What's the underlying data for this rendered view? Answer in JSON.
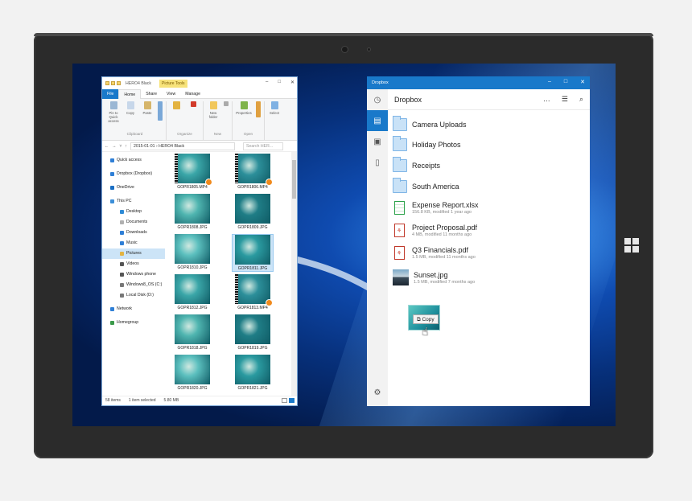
{
  "explorer": {
    "title": "HERO4 Black",
    "context_tab": "Picture Tools",
    "window_controls": [
      "–",
      "□",
      "✕"
    ],
    "tabs": [
      "File",
      "Home",
      "Share",
      "View",
      "Manage"
    ],
    "ribbon": {
      "clipboard": {
        "label": "Clipboard",
        "buttons": [
          "Pin to Quick access",
          "Copy",
          "Paste"
        ]
      },
      "organize": {
        "label": "Organize"
      },
      "new": {
        "label": "New",
        "buttons": [
          "New folder"
        ]
      },
      "open": {
        "label": "Open",
        "buttons": [
          "Properties"
        ]
      },
      "select": {
        "label": "Select"
      }
    },
    "address": {
      "path": "2015-01-01 › HERO4 Black",
      "search_placeholder": "Search HER..."
    },
    "nav": [
      {
        "label": "Quick access",
        "color": "#2f7fd6"
      },
      {
        "label": "Dropbox (Dropbox)",
        "color": "#2f7fd6"
      },
      {
        "label": "OneDrive",
        "color": "#1b6fc4"
      },
      {
        "label": "This PC",
        "color": "#3c8fd8"
      },
      {
        "label": "Desktop",
        "color": "#2f8bd6"
      },
      {
        "label": "Documents",
        "color": "#b0b0b0"
      },
      {
        "label": "Downloads",
        "color": "#2f7fd6"
      },
      {
        "label": "Music",
        "color": "#2f7fd6"
      },
      {
        "label": "Pictures",
        "color": "#e3b341"
      },
      {
        "label": "Videos",
        "color": "#555"
      },
      {
        "label": "Windows phone",
        "color": "#555"
      },
      {
        "label": "Windows8_OS (C:)",
        "color": "#777"
      },
      {
        "label": "Local Disk (D:)",
        "color": "#777"
      },
      {
        "label": "Network",
        "color": "#2f7fd6"
      },
      {
        "label": "Homegroup",
        "color": "#3a9a4a"
      }
    ],
    "files": [
      {
        "name": "GOPR1805.MP4",
        "video": true
      },
      {
        "name": "GOPR1806.MP4",
        "video": true
      },
      {
        "name": "GOPR1808.JPG",
        "video": false
      },
      {
        "name": "GOPR1809.JPG",
        "video": false
      },
      {
        "name": "GOPR1810.JPG",
        "video": false
      },
      {
        "name": "GOPR1811.JPG",
        "video": false,
        "selected": true
      },
      {
        "name": "GOPR1812.JPG",
        "video": false
      },
      {
        "name": "GOPR1813.MP4",
        "video": true
      },
      {
        "name": "GOPR1818.JPG",
        "video": false
      },
      {
        "name": "GOPR1819.JPG",
        "video": false
      },
      {
        "name": "GOPR1820.JPG",
        "video": false
      },
      {
        "name": "GOPR1821.JPG",
        "video": false
      }
    ],
    "status": {
      "items": "58 items",
      "selection": "1 item selected",
      "size": "5.80 MB"
    }
  },
  "dropbox": {
    "app_title": "Dropbox",
    "header": "Dropbox",
    "window_controls": [
      "–",
      "□",
      "✕"
    ],
    "tools": [
      "…",
      "☰",
      "⌕"
    ],
    "items": [
      {
        "name": "Camera Uploads",
        "meta": "",
        "kind": "folder"
      },
      {
        "name": "Holiday Photos",
        "meta": "",
        "kind": "folder"
      },
      {
        "name": "Receipts",
        "meta": "",
        "kind": "folder"
      },
      {
        "name": "South America",
        "meta": "",
        "kind": "folder"
      },
      {
        "name": "Expense Report.xlsx",
        "meta": "156.8 KB, modified 1 year ago",
        "kind": "xlsx"
      },
      {
        "name": "Project Proposal.pdf",
        "meta": "4 MB, modified 11 months ago",
        "kind": "pdf"
      },
      {
        "name": "Q3 Financials.pdf",
        "meta": "1.5 MB, modified 11 months ago",
        "kind": "pdf"
      },
      {
        "name": "Sunset.jpg",
        "meta": "1.5 MB, modified 7 months ago",
        "kind": "photo"
      }
    ],
    "drag_label": "Copy"
  },
  "colors": {
    "accent": "#1979ca",
    "explorer_selection": "#cce4f7"
  }
}
